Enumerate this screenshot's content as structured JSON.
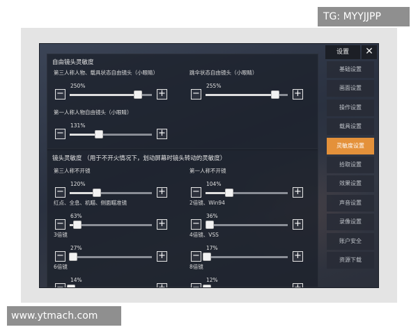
{
  "watermarks": {
    "top_right": "TG: MYYJJPP",
    "bottom_left": "www.ytmach.com"
  },
  "sidebar": {
    "title": "设置",
    "close_glyph": "✕",
    "items": [
      {
        "label": "基础设置",
        "active": false
      },
      {
        "label": "画面设置",
        "active": false
      },
      {
        "label": "操作设置",
        "active": false
      },
      {
        "label": "载具设置",
        "active": false
      },
      {
        "label": "灵敏度设置",
        "active": true
      },
      {
        "label": "拾取设置",
        "active": false
      },
      {
        "label": "效果设置",
        "active": false
      },
      {
        "label": "声音设置",
        "active": false
      },
      {
        "label": "录像设置",
        "active": false
      },
      {
        "label": "账户安全",
        "active": false
      },
      {
        "label": "资源下载",
        "active": false
      }
    ]
  },
  "free_look": {
    "title": "自由镜头灵敏度",
    "sliders": [
      {
        "label": "第三人称人物、载具状态自由镜头（小眼睛）",
        "value": "250%",
        "fraction": 0.83
      },
      {
        "label": "跳伞状态自由镜头（小眼睛）",
        "value": "255%",
        "fraction": 0.85
      },
      {
        "label": "第一人称人物自由镜头（小眼睛）",
        "value": "131%",
        "fraction": 0.36
      }
    ]
  },
  "scope": {
    "title": "镜头灵敏度 （用于不开火情况下，划动屏幕时镜头转动的灵敏度）",
    "sliders": [
      {
        "label": "第三人称不开镜",
        "value": "120%",
        "fraction": 0.33
      },
      {
        "label": "第一人称不开镜",
        "value": "104%",
        "fraction": 0.29
      },
      {
        "label": "红点、全息、机瞄、侧面瞄准镜",
        "value": "63%",
        "fraction": 0.09
      },
      {
        "label": "2倍镜、Win94",
        "value": "36%",
        "fraction": 0.05
      },
      {
        "label": "3倍镜",
        "value": "27%",
        "fraction": 0.04
      },
      {
        "label": "4倍镜、VSS",
        "value": "17%",
        "fraction": 0.02
      },
      {
        "label": "6倍镜",
        "value": "14%",
        "fraction": 0.02
      },
      {
        "label": "8倍镜",
        "value": "12%",
        "fraction": 0.02
      }
    ]
  },
  "controls": {
    "minus_glyph": "−",
    "plus_glyph": "+"
  },
  "colors": {
    "accent": "#e4913a",
    "panel": "#1c212c",
    "text": "#dcdcdc"
  }
}
